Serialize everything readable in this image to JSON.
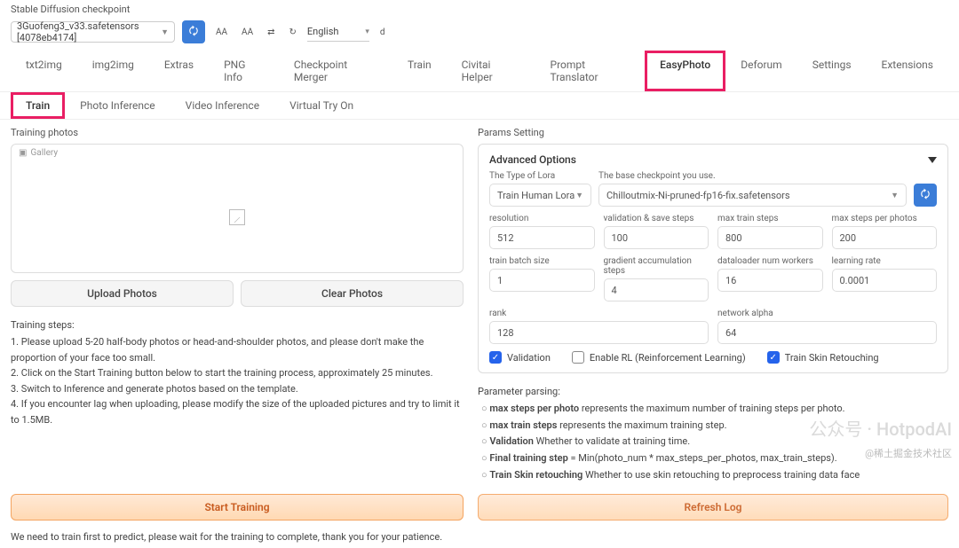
{
  "header": {
    "checkpoint_label": "Stable Diffusion checkpoint",
    "checkpoint_value": "3Guofeng3_v33.safetensors [4078eb4174]",
    "language": "English",
    "extra_letter": "d",
    "font_tokens": [
      "AA",
      "AA",
      "⇄",
      "↻"
    ]
  },
  "main_tabs": [
    "txt2img",
    "img2img",
    "Extras",
    "PNG Info",
    "Checkpoint Merger",
    "Train",
    "Civitai Helper",
    "Prompt Translator",
    "EasyPhoto",
    "Deforum",
    "Settings",
    "Extensions"
  ],
  "main_tab_highlight": "EasyPhoto",
  "sub_tabs": [
    "Train",
    "Photo Inference",
    "Video Inference",
    "Virtual Try On"
  ],
  "sub_tab_highlight": "Train",
  "left": {
    "section_label": "Training photos",
    "gallery_label": "Gallery",
    "upload_btn": "Upload Photos",
    "clear_btn": "Clear Photos",
    "steps_title": "Training steps:",
    "steps": [
      "1. Please upload 5-20 half-body photos or head-and-shoulder photos, and please don't make the proportion of your face too small.",
      "2. Click on the Start Training button below to start the training process, approximately 25 minutes.",
      "3. Switch to Inference and generate photos based on the template.",
      "4. If you encounter lag when uploading, please modify the size of the uploaded pictures and try to limit it to 1.5MB."
    ]
  },
  "right": {
    "section_label": "Params Setting",
    "adv_title": "Advanced Options",
    "lora_label": "The Type of Lora",
    "lora_value": "Train Human Lora",
    "base_label": "The base checkpoint you use.",
    "base_value": "Chilloutmix-Ni-pruned-fp16-fix.safetensors",
    "fields": {
      "resolution": {
        "label": "resolution",
        "value": "512"
      },
      "val_save": {
        "label": "validation & save steps",
        "value": "100"
      },
      "max_train": {
        "label": "max train steps",
        "value": "800"
      },
      "max_per_photo": {
        "label": "max steps per photos",
        "value": "200"
      },
      "batch": {
        "label": "train batch size",
        "value": "1"
      },
      "grad_accum": {
        "label": "gradient accumulation steps",
        "value": "4"
      },
      "workers": {
        "label": "dataloader num workers",
        "value": "16"
      },
      "lr": {
        "label": "learning rate",
        "value": "0.0001"
      },
      "rank": {
        "label": "rank",
        "value": "128"
      },
      "alpha": {
        "label": "network alpha",
        "value": "64"
      }
    },
    "checks": {
      "validation": {
        "label": "Validation",
        "checked": true
      },
      "rl": {
        "label": "Enable RL (Reinforcement Learning)",
        "checked": false
      },
      "retouch": {
        "label": "Train Skin Retouching",
        "checked": true
      }
    },
    "param_parse_title": "Parameter parsing:",
    "param_parse": [
      {
        "b": "max steps per photo",
        "t": " represents the maximum number of training steps per photo."
      },
      {
        "b": "max train steps",
        "t": " represents the maximum training step."
      },
      {
        "b": "Validation",
        "t": " Whether to validate at training time."
      },
      {
        "b": "Final training step",
        "t": " = Min(photo_num * max_steps_per_photos, max_train_steps)."
      },
      {
        "b": "Train Skin retouching",
        "t": " Whether to use skin retouching to preprocess training data face"
      }
    ]
  },
  "bottom": {
    "start": "Start Training",
    "refresh": "Refresh Log",
    "note": "We need to train first to predict, please wait for the training to complete, thank you for your patience."
  },
  "watermark": "公众号 · HotpodAI",
  "watermark2": "@稀土掘金技术社区"
}
